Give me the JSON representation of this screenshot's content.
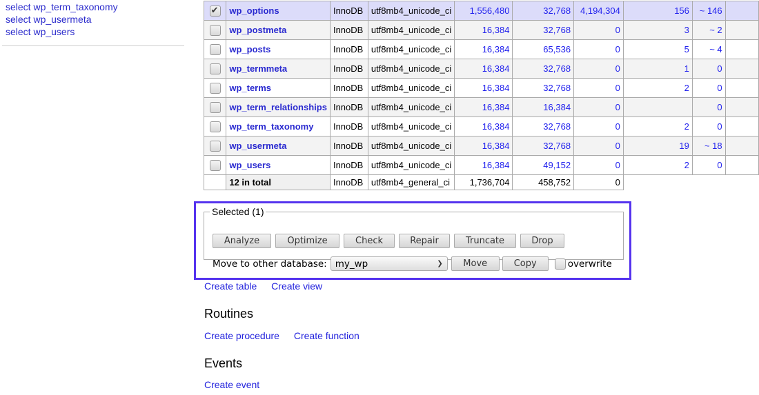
{
  "sidebar": {
    "links": [
      "select wp_term_taxonomy",
      "select wp_usermeta",
      "select wp_users"
    ]
  },
  "table": {
    "rows": [
      {
        "checked": true,
        "name": "wp_options",
        "engine": "InnoDB",
        "collation": "utf8mb4_unicode_ci",
        "data": "1,556,480",
        "index": "32,768",
        "free": "4,194,304",
        "rows": "156",
        "overhead": "~ 146"
      },
      {
        "checked": false,
        "name": "wp_postmeta",
        "engine": "InnoDB",
        "collation": "utf8mb4_unicode_ci",
        "data": "16,384",
        "index": "32,768",
        "free": "0",
        "rows": "3",
        "overhead": "~ 2"
      },
      {
        "checked": false,
        "name": "wp_posts",
        "engine": "InnoDB",
        "collation": "utf8mb4_unicode_ci",
        "data": "16,384",
        "index": "65,536",
        "free": "0",
        "rows": "5",
        "overhead": "~ 4"
      },
      {
        "checked": false,
        "name": "wp_termmeta",
        "engine": "InnoDB",
        "collation": "utf8mb4_unicode_ci",
        "data": "16,384",
        "index": "32,768",
        "free": "0",
        "rows": "1",
        "overhead": "0"
      },
      {
        "checked": false,
        "name": "wp_terms",
        "engine": "InnoDB",
        "collation": "utf8mb4_unicode_ci",
        "data": "16,384",
        "index": "32,768",
        "free": "0",
        "rows": "2",
        "overhead": "0"
      },
      {
        "checked": false,
        "name": "wp_term_relationships",
        "engine": "InnoDB",
        "collation": "utf8mb4_unicode_ci",
        "data": "16,384",
        "index": "16,384",
        "free": "0",
        "rows": "",
        "overhead": "0"
      },
      {
        "checked": false,
        "name": "wp_term_taxonomy",
        "engine": "InnoDB",
        "collation": "utf8mb4_unicode_ci",
        "data": "16,384",
        "index": "32,768",
        "free": "0",
        "rows": "2",
        "overhead": "0"
      },
      {
        "checked": false,
        "name": "wp_usermeta",
        "engine": "InnoDB",
        "collation": "utf8mb4_unicode_ci",
        "data": "16,384",
        "index": "32,768",
        "free": "0",
        "rows": "19",
        "overhead": "~ 18"
      },
      {
        "checked": false,
        "name": "wp_users",
        "engine": "InnoDB",
        "collation": "utf8mb4_unicode_ci",
        "data": "16,384",
        "index": "49,152",
        "free": "0",
        "rows": "2",
        "overhead": "0"
      }
    ],
    "total": {
      "label": "12 in total",
      "engine": "InnoDB",
      "collation": "utf8mb4_general_ci",
      "data": "1,736,704",
      "index": "458,752",
      "free": "0"
    }
  },
  "selected": {
    "legend": "Selected (1)",
    "buttons": [
      "Analyze",
      "Optimize",
      "Check",
      "Repair",
      "Truncate",
      "Drop"
    ],
    "move_label": "Move to other database:",
    "database": "my_wp",
    "move_button": "Move",
    "copy_button": "Copy",
    "overwrite_label": "overwrite",
    "overwrite_checked": false
  },
  "tables_links": {
    "create_table": "Create table",
    "create_view": "Create view"
  },
  "routines": {
    "heading": "Routines",
    "create_procedure": "Create procedure",
    "create_function": "Create function"
  },
  "events": {
    "heading": "Events",
    "create_event": "Create event"
  },
  "colors": {
    "link": "#2222ee",
    "selected_row": "#dcdcfa",
    "highlight_border": "#5533ee"
  }
}
